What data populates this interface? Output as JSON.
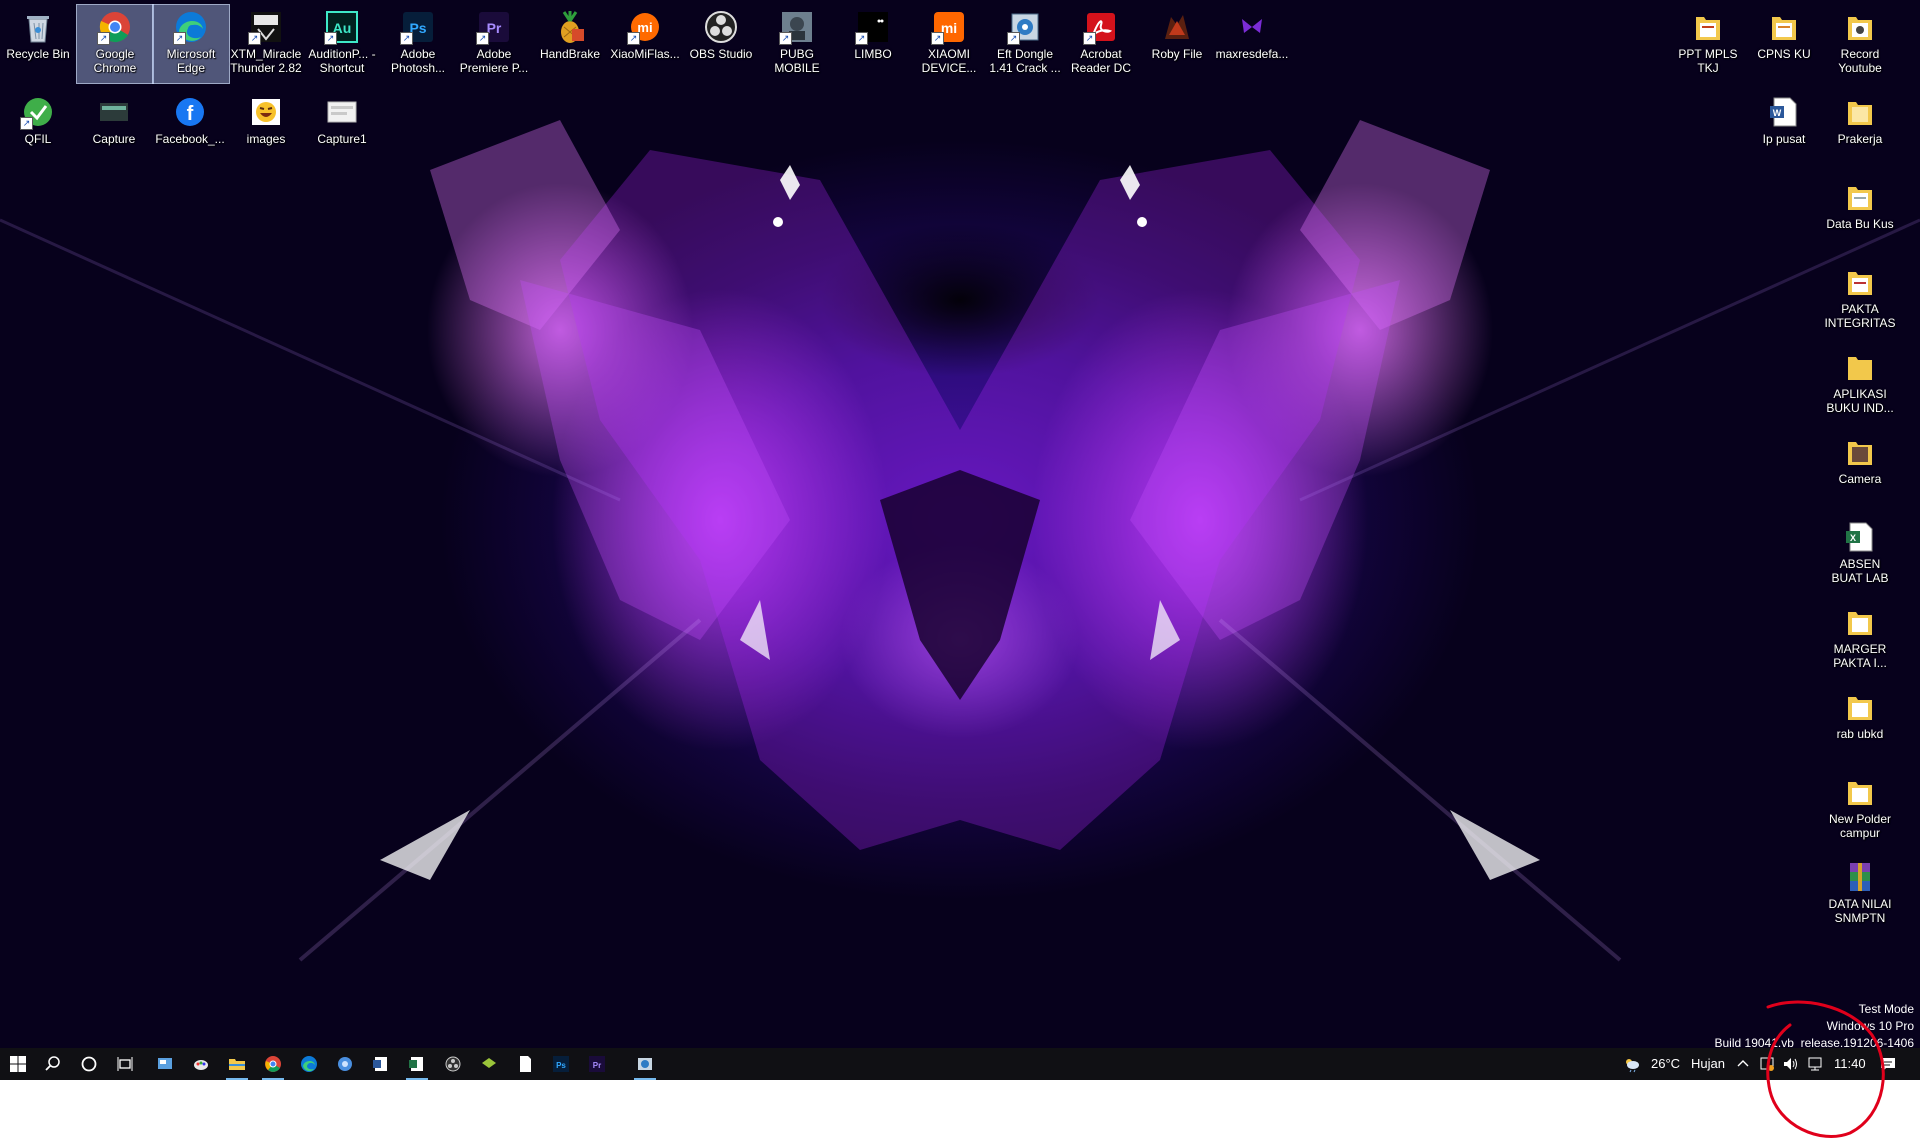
{
  "desktop_icons": {
    "recycle_bin": "Recycle Bin",
    "google_chrome": "Google Chrome",
    "microsoft_edge": "Microsoft Edge",
    "xtm_miracle": "XTM_Miracle Thunder 2.82",
    "audition": "AuditionP... - Shortcut",
    "photoshop": "Adobe Photosh...",
    "premiere": "Adobe Premiere P...",
    "handbrake": "HandBrake",
    "xiaomiflash": "XiaoMiFlas...",
    "obs": "OBS Studio",
    "pubg": "PUBG MOBILE",
    "limbo": "LIMBO",
    "xiaomi_device": "XIAOMI DEVICE...",
    "eft_dongle": "Eft Dongle 1.41 Crack ...",
    "acrobat": "Acrobat Reader DC",
    "roby": "Roby File",
    "maxresdefault": "maxresdefa...",
    "qfil": "QFIL",
    "capture": "Capture",
    "facebook": "Facebook_...",
    "images": "images",
    "capture1": "Capture1",
    "ppt_mpls": "PPT MPLS TKJ",
    "cpns": "CPNS KU",
    "record_youtube": "Record Youtube",
    "ip_pusat": "Ip pusat",
    "prakerja": "Prakerja",
    "data_bu_kus": "Data Bu Kus",
    "pakta": "PAKTA INTEGRITAS",
    "aplikasi": "APLIKASI BUKU IND...",
    "camera": "Camera",
    "absen": "ABSEN BUAT LAB",
    "marger": "MARGER PAKTA I...",
    "rab": "rab ubkd",
    "new_polder": "New Polder campur",
    "data_nilai": "DATA NILAI SNMPTN"
  },
  "watermark": {
    "line1": "Test Mode",
    "line2": "Windows 10 Pro",
    "line3": "Build 19041.vb_release.191206-1406"
  },
  "taskbar": {
    "weather_temp": "26°C",
    "weather_text": "Hujan",
    "clock": "11:40"
  },
  "colors": {
    "taskbar_bg": "#101014",
    "running_indicator": "#76b9ed",
    "annotation": "#e0001b"
  }
}
